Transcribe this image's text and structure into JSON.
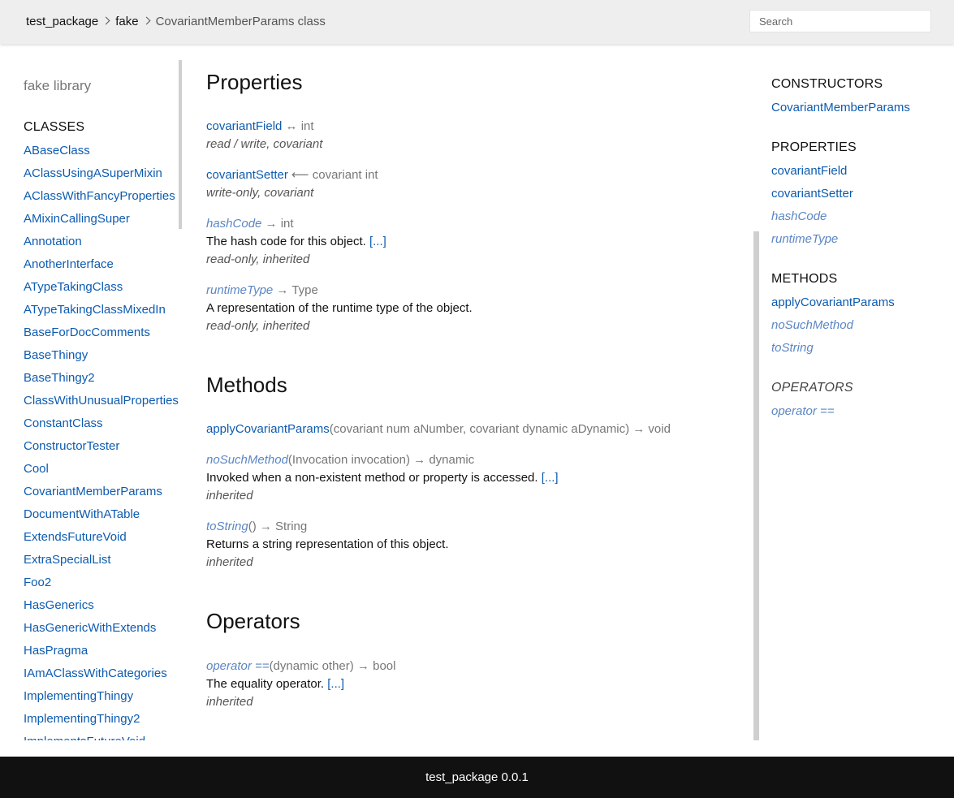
{
  "header": {
    "breadcrumbs": [
      "test_package",
      "fake",
      "CovariantMemberParams class"
    ],
    "search": {
      "placeholder": "Search",
      "value": ""
    }
  },
  "left_sidebar": {
    "library_title": "fake library",
    "classes_title": "CLASSES",
    "classes": [
      "ABaseClass",
      "AClassUsingASuperMixin",
      "AClassWithFancyProperties",
      "AMixinCallingSuper",
      "Annotation",
      "AnotherInterface",
      "ATypeTakingClass",
      "ATypeTakingClassMixedIn",
      "BaseForDocComments",
      "BaseThingy",
      "BaseThingy2",
      "ClassWithUnusualProperties",
      "ConstantClass",
      "ConstructorTester",
      "Cool",
      "CovariantMemberParams",
      "DocumentWithATable",
      "ExtendsFutureVoid",
      "ExtraSpecialList",
      "Foo2",
      "HasGenerics",
      "HasGenericWithExtends",
      "HasPragma",
      "IAmAClassWithCategories",
      "ImplementingThingy",
      "ImplementingThingy2",
      "ImplementsFutureVoid"
    ]
  },
  "main": {
    "properties_title": "Properties",
    "properties": [
      {
        "name": "covariantField",
        "rest": " ↔ int",
        "desc": "",
        "more": "",
        "features": "read / write, covariant"
      },
      {
        "name": "covariantSetter",
        "rest": " ⟵ covariant int",
        "desc": "",
        "more": "",
        "features": "write-only, covariant"
      },
      {
        "name": "hashCode",
        "rest": " → int",
        "desc": "The hash code for this object. ",
        "more": "[...]",
        "features": "read-only, inherited"
      },
      {
        "name": "runtimeType",
        "rest": " → Type",
        "desc": "A representation of the runtime type of the object.",
        "more": "",
        "features": "read-only, inherited"
      }
    ],
    "methods_title": "Methods",
    "methods": [
      {
        "name": "applyCovariantParams",
        "rest": "(covariant num aNumber, covariant dynamic aDynamic) → void",
        "desc": "",
        "more": "",
        "features": ""
      },
      {
        "name": "noSuchMethod",
        "rest": "(Invocation invocation) → dynamic",
        "desc": "Invoked when a non-existent method or property is accessed. ",
        "more": "[...]",
        "features": "inherited"
      },
      {
        "name": "toString",
        "rest": "() → String",
        "desc": "Returns a string representation of this object.",
        "more": "",
        "features": "inherited"
      }
    ],
    "operators_title": "Operators",
    "operators": [
      {
        "name": "operator ==",
        "rest": "(dynamic other) → bool",
        "desc": "The equality operator. ",
        "more": "[...]",
        "features": "inherited"
      }
    ]
  },
  "right_sidebar": {
    "constructors_title": "CONSTRUCTORS",
    "constructors": [
      "CovariantMemberParams"
    ],
    "properties_title": "PROPERTIES",
    "properties": [
      "covariantField",
      "covariantSetter",
      "hashCode",
      "runtimeType"
    ],
    "methods_title": "METHODS",
    "methods": [
      "applyCovariantParams",
      "noSuchMethod",
      "toString"
    ],
    "operators_title": "OPERATORS",
    "operators": [
      "operator =="
    ]
  },
  "footer": {
    "text": "test_package 0.0.1"
  }
}
